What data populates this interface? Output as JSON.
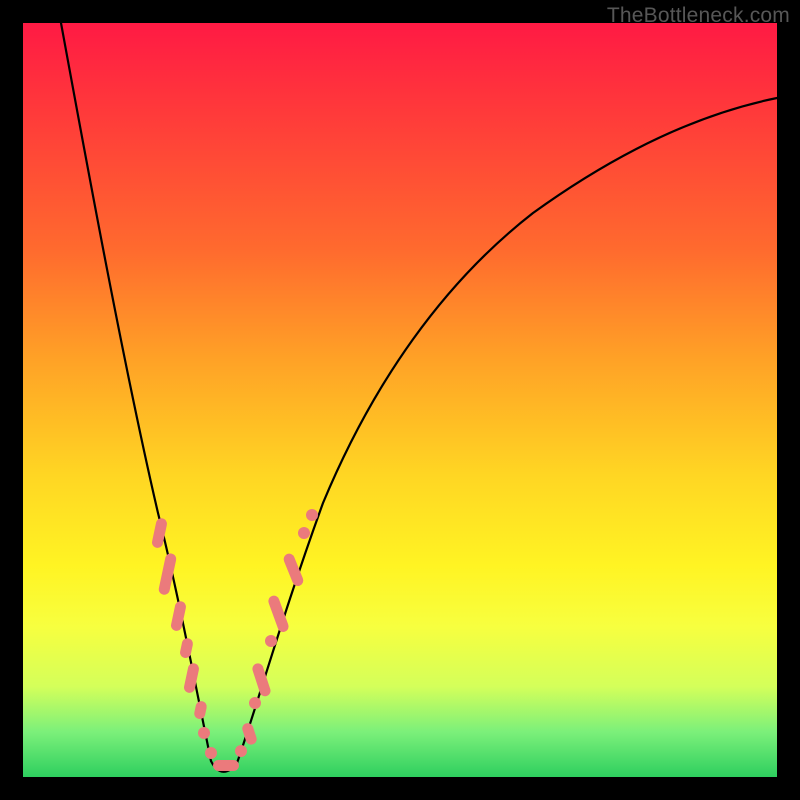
{
  "watermark": "TheBottleneck.com",
  "colors": {
    "frame": "#000000",
    "gradient_top": "#ff1a44",
    "gradient_mid1": "#ffa326",
    "gradient_mid2": "#fff423",
    "gradient_bottom": "#2ecf5f",
    "curve": "#000000",
    "marker": "#eb7a7c"
  },
  "chart_data": {
    "type": "line",
    "title": "",
    "xlabel": "",
    "ylabel": "",
    "xlim": [
      0,
      100
    ],
    "ylim": [
      0,
      100
    ],
    "note": "Axes have no visible tick labels; values are qualitative bottleneck percentages estimated from position. Curve is a V-shape with minimum near x≈25, y≈0; markers cluster on both branches near the bottom (low bottleneck region).",
    "series": [
      {
        "name": "bottleneck-curve",
        "x": [
          5,
          8,
          11,
          14,
          17,
          20,
          23,
          25,
          27,
          30,
          35,
          40,
          50,
          60,
          70,
          80,
          90,
          100
        ],
        "y": [
          100,
          85,
          70,
          55,
          40,
          25,
          10,
          0,
          8,
          20,
          38,
          52,
          70,
          80,
          87,
          92,
          96,
          99
        ]
      }
    ],
    "markers": {
      "name": "highlighted-points",
      "x": [
        18,
        19,
        20,
        21,
        22,
        23,
        24,
        25,
        26,
        27,
        28,
        29,
        30,
        31,
        32
      ],
      "y": [
        32,
        27,
        22,
        16,
        10,
        5,
        2,
        0,
        2,
        6,
        11,
        17,
        23,
        28,
        33
      ]
    }
  }
}
